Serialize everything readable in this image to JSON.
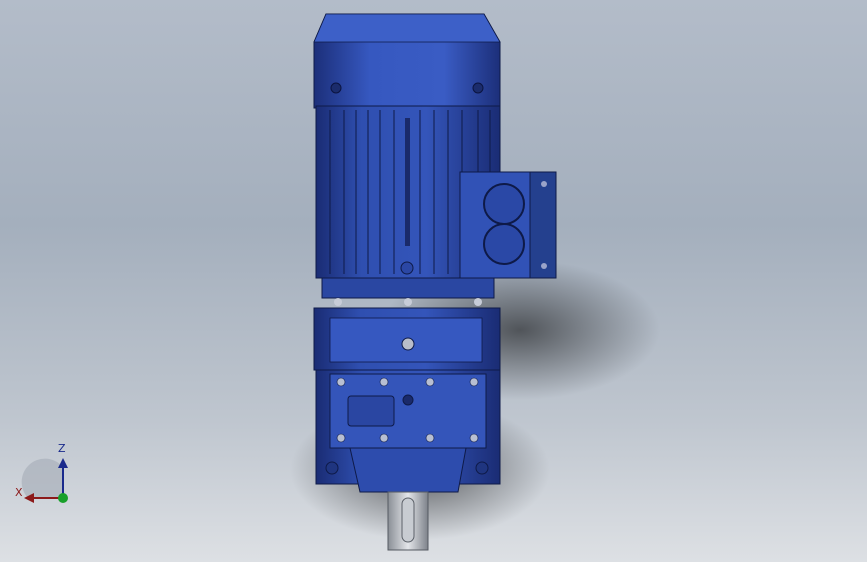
{
  "viewport": {
    "background_top": "#b3bcc9",
    "background_bottom": "#dde0e4"
  },
  "model": {
    "description_name": "gear-motor-assembly",
    "body_color": "#2f4fb0",
    "body_dark": "#1c2f7a",
    "body_light": "#4a6fd0"
  },
  "triad": {
    "z_label": "Z",
    "x_label": "X",
    "z_color": "#1a2a8c",
    "x_color": "#8c1a1a",
    "origin_color": "#18a02a"
  }
}
